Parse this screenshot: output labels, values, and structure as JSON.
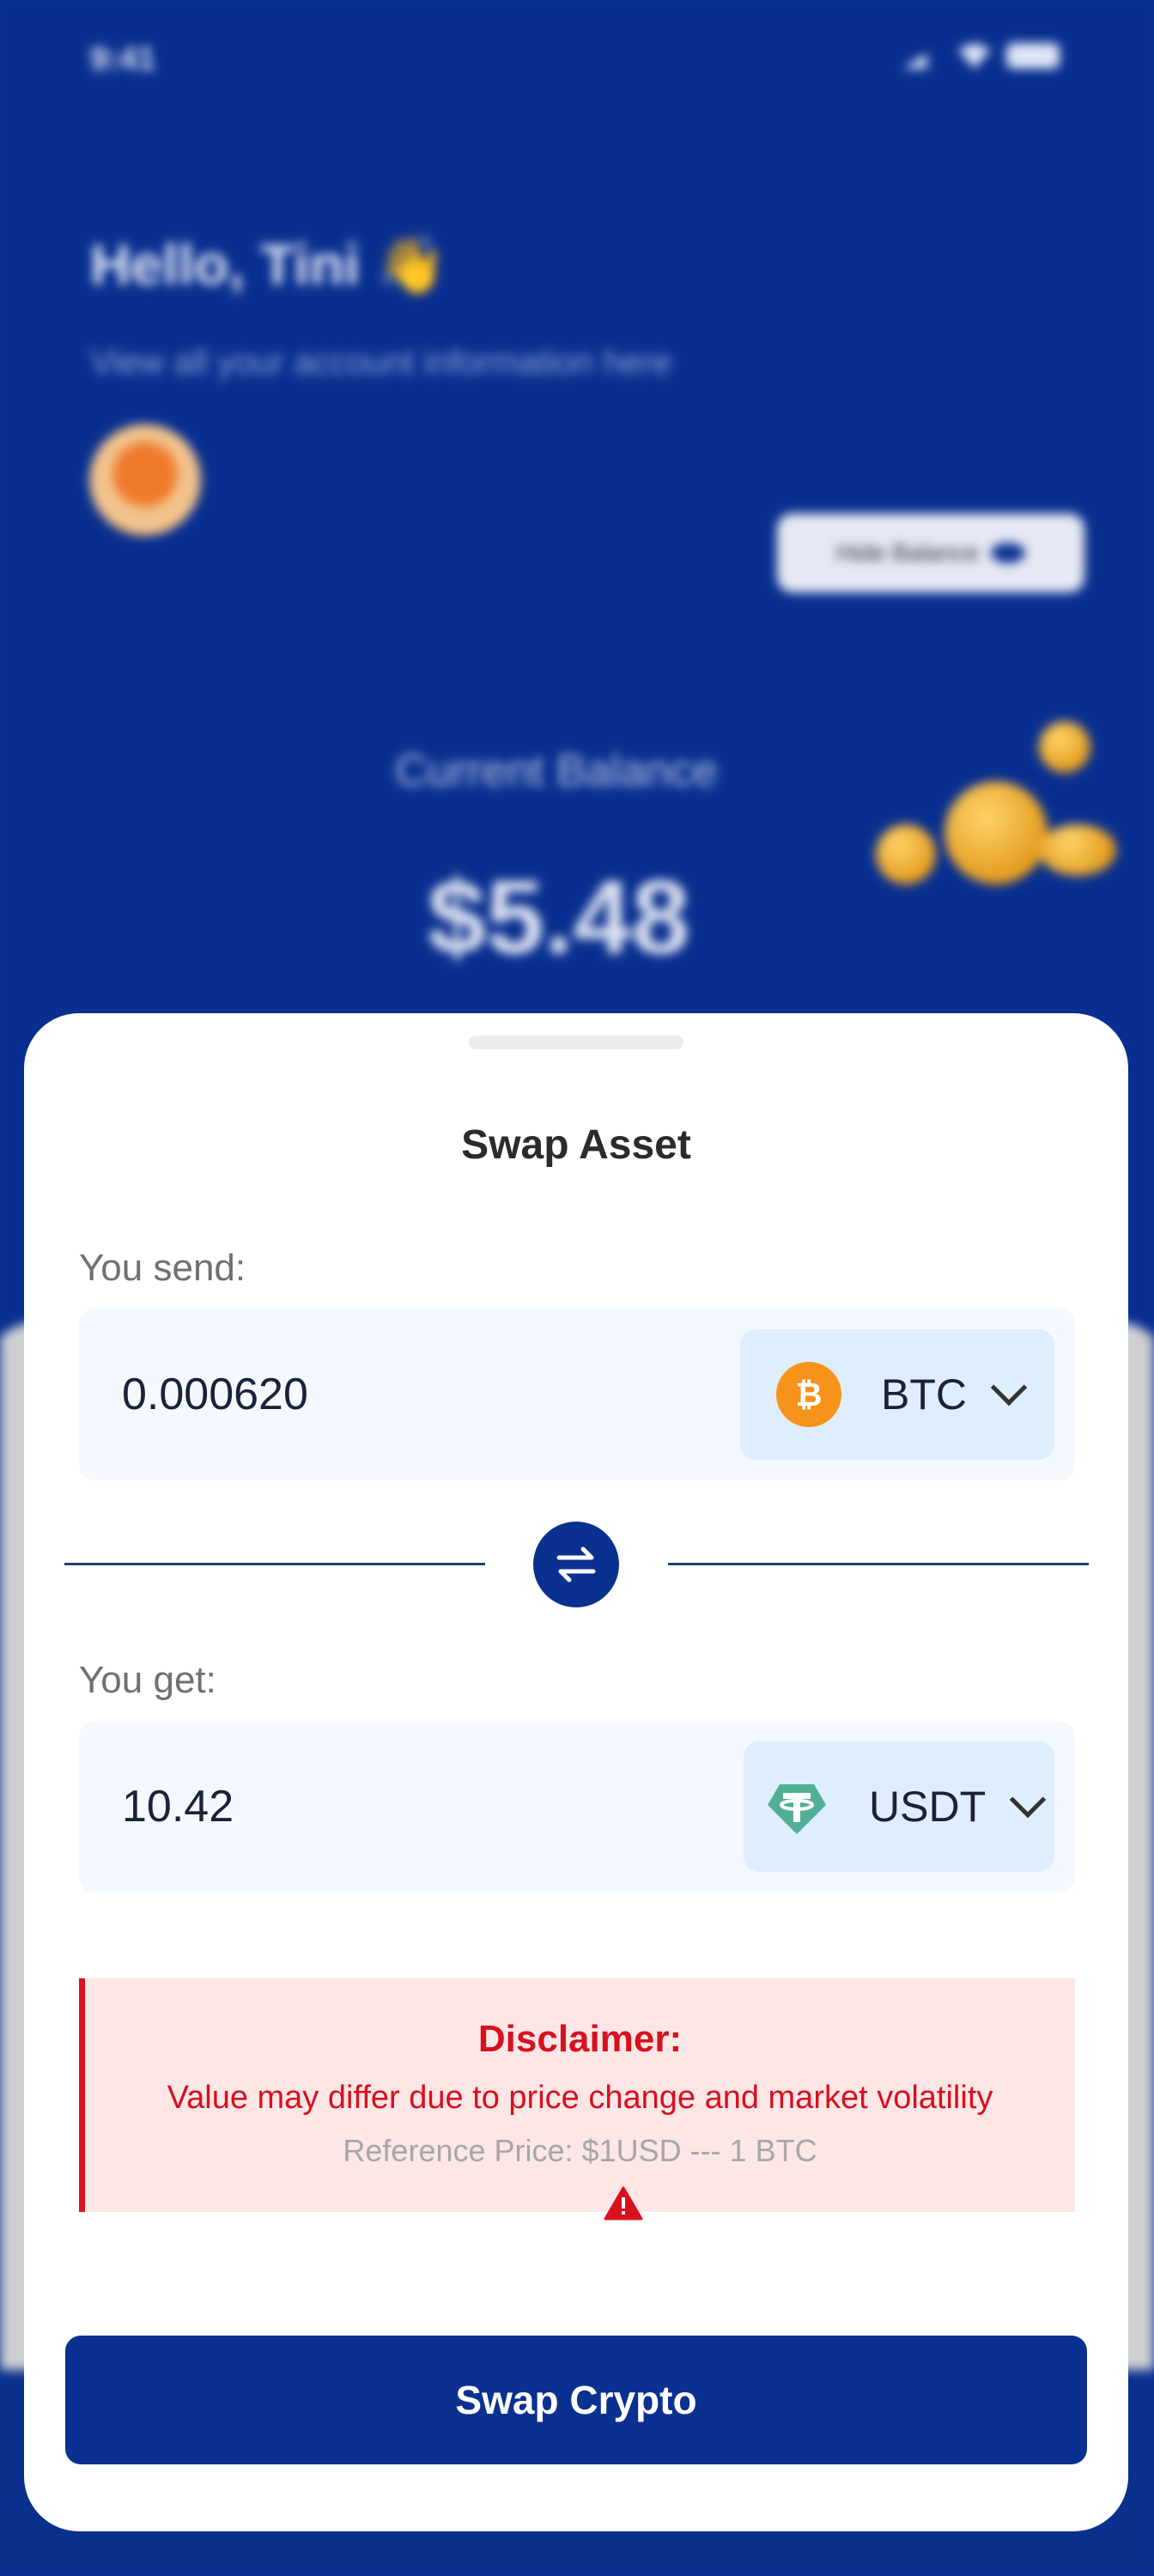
{
  "background": {
    "status_time": "9:41",
    "greeting": "Hello, Tini 👋",
    "greeting_subtitle": "View all your account information here",
    "hide_balance_label": "Hide Balance",
    "balance_label": "Current Balance",
    "balance_value": "$5.48"
  },
  "sheet": {
    "title": "Swap Asset",
    "send": {
      "label": "You send:",
      "amount": "0.000620",
      "asset": "BTC",
      "asset_icon": "bitcoin-icon",
      "asset_color": "#f7931a"
    },
    "get": {
      "label": "You get:",
      "amount": "10.42",
      "asset": "USDT",
      "asset_icon": "tether-icon",
      "asset_color": "#50af95"
    },
    "disclaimer": {
      "title": "Disclaimer:",
      "text": "Value may differ due to price change and market volatility",
      "reference": "Reference Price: $1USD --- 1 BTC"
    },
    "submit_label": "Swap Crypto"
  },
  "colors": {
    "primary": "#0a3090",
    "danger": "#d8101e",
    "danger_bg": "#fde6e6",
    "input_bg": "#f4f8ff",
    "select_bg": "#dfeefe"
  }
}
